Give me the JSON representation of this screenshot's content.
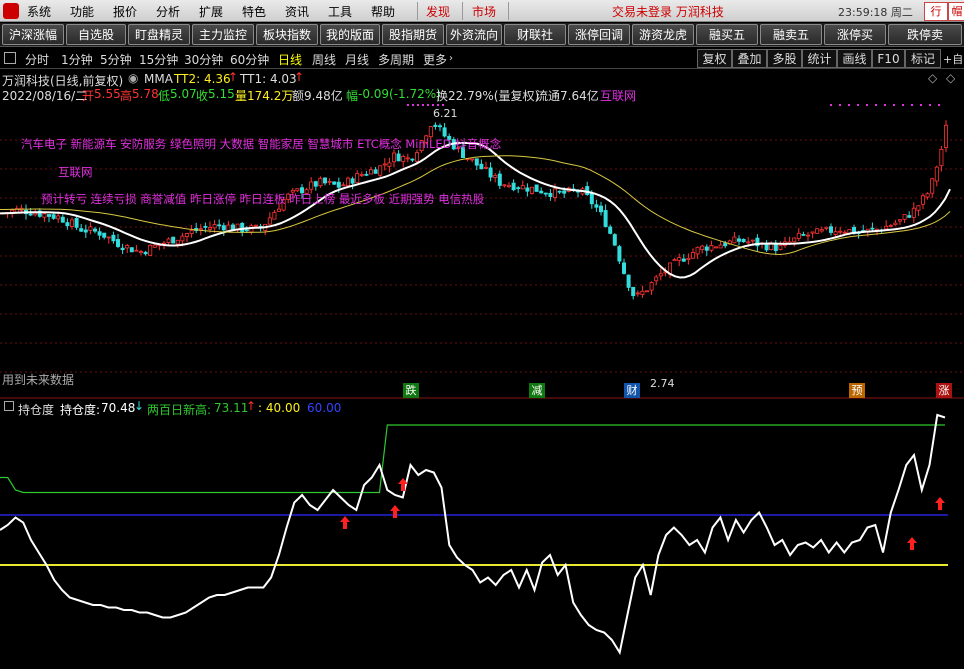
{
  "menubar": {
    "items": [
      "系统",
      "功能",
      "报价",
      "分析",
      "扩展",
      "特色",
      "资讯",
      "工具",
      "帮助"
    ],
    "tabs": [
      "发现",
      "市场"
    ],
    "login_text": "交易未登录 万润科技",
    "clock": "23:59:18 周二",
    "right_buttons": [
      "行",
      "帽"
    ]
  },
  "toolbar": {
    "buttons": [
      "沪深涨幅",
      "自选股",
      "盯盘精灵",
      "主力监控",
      "板块指数",
      "我的版面",
      "股指期货",
      "外资流向",
      "财联社",
      "涨停回调",
      "游资龙虎",
      "融买五",
      "融卖五",
      "涨停买",
      "跌停卖"
    ]
  },
  "periods": {
    "items": [
      "分时",
      "1分钟",
      "5分钟",
      "15分钟",
      "30分钟",
      "60分钟",
      "日线",
      "周线",
      "月线",
      "多周期",
      "更多"
    ],
    "active": "日线",
    "right_buttons": [
      "复权",
      "叠加",
      "多股",
      "统计",
      "画线",
      "F10",
      "标记"
    ],
    "right_arrow": "+自"
  },
  "info": {
    "title": "万润科技(日线,前复权)",
    "mma_label": "MMA",
    "tt2": "TT2: 4.36",
    "tt1": "TT1: 4.03",
    "date": "2022/08/16/二",
    "open_label": "开",
    "open": "5.55",
    "high_label": "高",
    "high": "5.78",
    "low_label": "低",
    "low": "5.07",
    "close_label": "收",
    "close": "5.15",
    "vol_label": "量",
    "vol": "174.2万",
    "amount_label": "额",
    "amount": "9.48亿",
    "change_label": "幅",
    "change": "-0.09(-1.72%)",
    "turnover": "换22.79%(量复权)",
    "float": "流通7.64亿",
    "sector": "互联网"
  },
  "concepts": {
    "line1": "汽车电子 新能源车 安防服务 绿色照明 大数据 智能家居 智慧城市 ETC概念 MiniLED 抖音概念",
    "line2": "互联网",
    "line3": "预计转亏 连续亏损 商誉减值 昨日涨停 昨日连板 昨日上榜 最近多板 近期强势 电信热股"
  },
  "labels": {
    "high_price": "6.21",
    "low_price": "2.74",
    "future": "用到未来数据",
    "bottom_tags": [
      "跌",
      "减",
      "财",
      "预",
      "涨"
    ]
  },
  "lower": {
    "name": "持仓度",
    "hold_label": "持仓度:",
    "hold_value": "70.48",
    "new_high_label": "两百日新高:",
    "new_high_value": "73.11",
    "level40": ": 40.00",
    "level60": "60.00"
  },
  "colors": {
    "up": "#ff3333",
    "down": "#33dddd",
    "white_line": "#ffffff",
    "yellow_line": "#d8c840",
    "magenta": "#e030e0",
    "green_line": "#2fc82f",
    "blue_line": "#2222dd"
  },
  "chart_data": {
    "type": "candlestick",
    "price_high": 6.21,
    "price_low": 2.74,
    "series": [
      {
        "name": "持仓度",
        "values": [
          54,
          56,
          59,
          57,
          50,
          45,
          40,
          34,
          30,
          27,
          26,
          25,
          24,
          24,
          23,
          23,
          22,
          22,
          21,
          21,
          20,
          19,
          19,
          20,
          21,
          23,
          25,
          27,
          28,
          28,
          29,
          30,
          31,
          31,
          31,
          35,
          44,
          55,
          65,
          68,
          64,
          62,
          66,
          70,
          67,
          64,
          62,
          72,
          75,
          80,
          70,
          68,
          67,
          80,
          76,
          78,
          77,
          71,
          48,
          43,
          40,
          38,
          33,
          35,
          32,
          36,
          38,
          31,
          38,
          30,
          41,
          44,
          36,
          40,
          25,
          20,
          16,
          14,
          13,
          10,
          5,
          20,
          35,
          40,
          28,
          44,
          52,
          55,
          52,
          48,
          50,
          45,
          55,
          59,
          50,
          58,
          53,
          58,
          61,
          55,
          48,
          50,
          44,
          48,
          49,
          47,
          50,
          45,
          49,
          45,
          49,
          50,
          55,
          56,
          45,
          61,
          70,
          80,
          84,
          70,
          80,
          100,
          99
        ]
      },
      {
        "name": "两百日新高",
        "values": [
          75,
          75,
          70,
          69,
          69,
          69,
          69,
          69,
          69,
          69,
          69,
          69,
          69,
          69,
          69,
          69,
          69,
          69,
          69,
          69,
          69,
          69,
          69,
          69,
          69,
          69,
          69,
          69,
          69,
          69,
          69,
          69,
          69,
          69,
          69,
          69,
          69,
          69,
          69,
          69,
          69,
          69,
          69,
          69,
          69,
          69,
          69,
          69,
          69,
          69,
          96,
          96,
          96,
          96,
          96,
          96,
          96,
          96,
          96,
          96,
          96,
          96,
          96,
          96,
          96,
          96,
          96,
          96,
          96,
          96,
          96,
          96,
          96,
          96,
          96,
          96,
          96,
          96,
          96,
          96,
          96,
          96,
          96,
          96,
          96,
          96,
          96,
          96,
          96,
          96,
          96,
          96,
          96,
          96,
          96,
          96,
          96,
          96,
          96,
          96,
          96,
          96,
          96,
          96,
          96,
          96,
          96,
          96,
          96,
          96,
          96,
          96,
          96,
          96,
          96,
          96,
          96,
          96,
          96,
          96,
          96,
          96,
          96
        ]
      },
      {
        "name": "40.00",
        "values": [
          40
        ]
      },
      {
        "name": "60.00",
        "values": [
          60
        ]
      }
    ]
  }
}
